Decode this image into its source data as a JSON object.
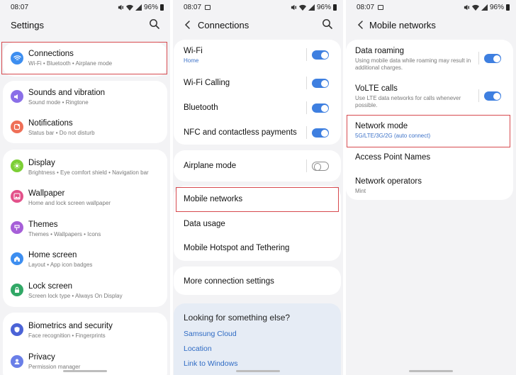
{
  "status": {
    "time": "08:07",
    "battery": "96%"
  },
  "panel1": {
    "title": "Settings",
    "groups": [
      [
        {
          "label": "Connections",
          "sub": "Wi-Fi  •  Bluetooth  •  Airplane mode",
          "icon": "wifi-icon",
          "color": "#3d8ef0"
        }
      ],
      [
        {
          "label": "Sounds and vibration",
          "sub": "Sound mode  •  Ringtone",
          "icon": "speaker-icon",
          "color": "#8a6fe8"
        },
        {
          "label": "Notifications",
          "sub": "Status bar  •  Do not disturb",
          "icon": "bell-icon",
          "color": "#ef6f57"
        }
      ],
      [
        {
          "label": "Display",
          "sub": "Brightness  •  Eye comfort shield  •  Navigation bar",
          "icon": "sun-icon",
          "color": "#7ccf35"
        },
        {
          "label": "Wallpaper",
          "sub": "Home and lock screen wallpaper",
          "icon": "image-icon",
          "color": "#e3518a"
        },
        {
          "label": "Themes",
          "sub": "Themes  •  Wallpapers  •  Icons",
          "icon": "brush-icon",
          "color": "#a65fd8"
        },
        {
          "label": "Home screen",
          "sub": "Layout  •  App icon badges",
          "icon": "home-icon",
          "color": "#3d8ef0"
        },
        {
          "label": "Lock screen",
          "sub": "Screen lock type  •  Always On Display",
          "icon": "lock-icon",
          "color": "#31a866"
        }
      ],
      [
        {
          "label": "Biometrics and security",
          "sub": "Face recognition  •  Fingerprints",
          "icon": "shield-icon",
          "color": "#4b63d6"
        },
        {
          "label": "Privacy",
          "sub": "Permission manager",
          "icon": "privacy-icon",
          "color": "#6a7fe8"
        }
      ]
    ]
  },
  "panel2": {
    "title": "Connections",
    "card1": [
      {
        "label": "Wi-Fi",
        "sub": "Home",
        "toggle": "on"
      },
      {
        "label": "Wi-Fi Calling",
        "sub": "",
        "toggle": "on"
      },
      {
        "label": "Bluetooth",
        "sub": "",
        "toggle": "on"
      },
      {
        "label": "NFC and contactless payments",
        "sub": "",
        "toggle": "on"
      }
    ],
    "card2": [
      {
        "label": "Airplane mode",
        "toggle": "off"
      }
    ],
    "card3": [
      {
        "label": "Mobile networks"
      },
      {
        "label": "Data usage"
      },
      {
        "label": "Mobile Hotspot and Tethering"
      }
    ],
    "card4": [
      {
        "label": "More connection settings"
      }
    ],
    "looking": {
      "title": "Looking for something else?",
      "links": [
        "Samsung Cloud",
        "Location",
        "Link to Windows"
      ]
    }
  },
  "panel3": {
    "title": "Mobile networks",
    "items": [
      {
        "label": "Data roaming",
        "sub": "Using mobile data while roaming may result in additional charges.",
        "toggle": "on"
      },
      {
        "label": "VoLTE calls",
        "sub": "Use LTE data networks for calls whenever possible.",
        "toggle": "on"
      },
      {
        "label": "Network mode",
        "sub": "5G/LTE/3G/2G (auto connect)"
      },
      {
        "label": "Access Point Names",
        "sub": ""
      },
      {
        "label": "Network operators",
        "sub": "Mint"
      }
    ]
  },
  "colors": {
    "accent": "#3e7fe0",
    "highlight": "#d74a4f",
    "link": "#2f6bc4"
  }
}
